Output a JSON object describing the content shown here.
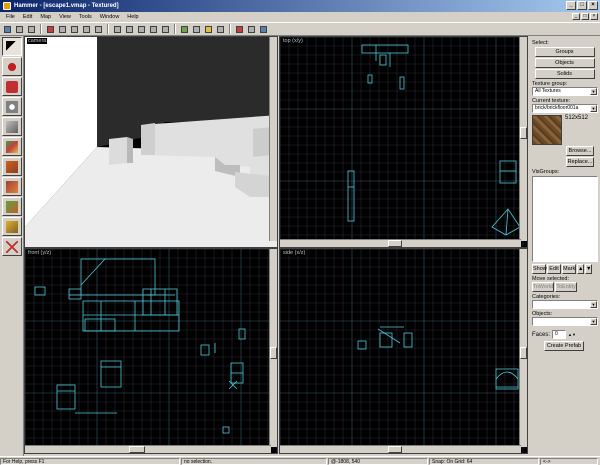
{
  "window": {
    "title": "Hammer - [escape1.vmap - Textured]"
  },
  "menu": [
    "File",
    "Edit",
    "Map",
    "View",
    "Tools",
    "Window",
    "Help"
  ],
  "viewports": {
    "camera": {
      "label": "camera"
    },
    "top": {
      "label": "top (x/y)"
    },
    "front": {
      "label": "front (y/z)"
    },
    "side": {
      "label": "side (x/z)"
    }
  },
  "panel": {
    "select_label": "Select:",
    "groups_button": "Groups",
    "objects_button": "Objects",
    "solids_button": "Solids",
    "texture_group_label": "Texture group:",
    "texture_group_value": "All Textures",
    "current_texture_label": "Current texture:",
    "current_texture_value": "brick/brickfloor001a",
    "texture_size": "512x512",
    "browse_button": "Browse...",
    "replace_button": "Replace...",
    "visgroups_label": "VisGroups:",
    "show_button": "Show",
    "edit_button": "Edit",
    "mark_button": "Mark",
    "move_selected_label": "Move selected:",
    "to_world_button": "ToWorld",
    "to_entity_button": "ToEntity",
    "categories_label": "Categories:",
    "objects_label": "Objects:",
    "faces_label": "Faces:",
    "faces_value": "0",
    "create_prefab_button": "Create Prefab"
  },
  "status": {
    "help": "For Help, press F1",
    "selection": "no selection.",
    "coords": "@-1808, 540",
    "snap": "Snap: On Grid: 64",
    "end": "<->"
  },
  "colors": {
    "grid": "#2a2a38",
    "grid_major": "#3a5a70",
    "brush": "#4ec9d8",
    "brush_white": "#e0ffff"
  }
}
